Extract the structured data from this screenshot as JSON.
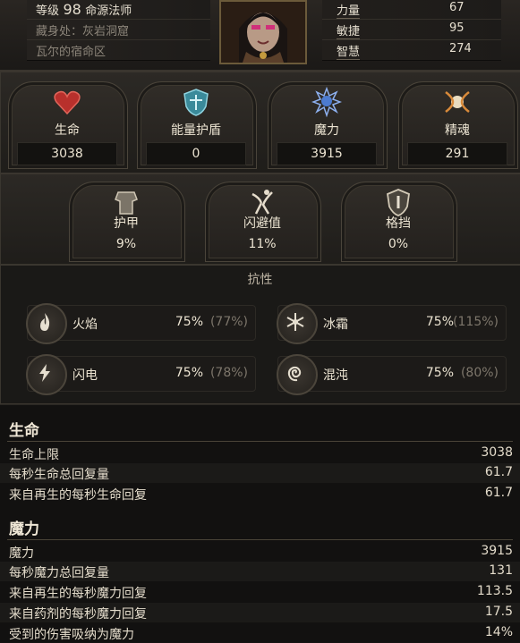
{
  "character": {
    "level_label": "等级",
    "level": "98",
    "class": "命源法师",
    "hideout_label": "藏身处：灰岩洞窟",
    "location": "瓦尔的宿命区"
  },
  "attributes": [
    {
      "name": "力量",
      "value": "67"
    },
    {
      "name": "敏捷",
      "value": "95"
    },
    {
      "name": "智慧",
      "value": "274"
    }
  ],
  "primary_stats": [
    {
      "name": "生命",
      "value": "3038",
      "icon": "heart-icon"
    },
    {
      "name": "能量护盾",
      "value": "0",
      "icon": "shield-crest-icon"
    },
    {
      "name": "魔力",
      "value": "3915",
      "icon": "mana-flower-icon"
    },
    {
      "name": "精魂",
      "value": "291",
      "icon": "spirit-orb-icon"
    }
  ],
  "defences": [
    {
      "name": "护甲",
      "value": "9%",
      "icon": "armour-icon"
    },
    {
      "name": "闪避值",
      "value": "11%",
      "icon": "evasion-icon"
    },
    {
      "name": "格挡",
      "value": "0%",
      "icon": "block-shield-icon"
    }
  ],
  "resistances": {
    "title": "抗性",
    "items": [
      {
        "name": "火焰",
        "value": "75%",
        "cap": "(77%)",
        "icon": "fire-icon"
      },
      {
        "name": "冰霜",
        "value": "75%",
        "cap": "(115%)",
        "icon": "snowflake-icon"
      },
      {
        "name": "闪电",
        "value": "75%",
        "cap": "(78%)",
        "icon": "lightning-icon"
      },
      {
        "name": "混沌",
        "value": "75%",
        "cap": "(80%)",
        "icon": "chaos-spiral-icon"
      }
    ]
  },
  "life_section": {
    "title": "生命",
    "rows": [
      {
        "label": "生命上限",
        "value": "3038"
      },
      {
        "label": "每秒生命总回复量",
        "value": "61.7"
      },
      {
        "label": "来自再生的每秒生命回复",
        "value": "61.7"
      }
    ]
  },
  "mana_section": {
    "title": "魔力",
    "rows": [
      {
        "label": "魔力",
        "value": "3915"
      },
      {
        "label": "每秒魔力总回复量",
        "value": "131"
      },
      {
        "label": "来自再生的每秒魔力回复",
        "value": "113.5"
      },
      {
        "label": "来自药剂的每秒魔力回复",
        "value": "17.5"
      },
      {
        "label": "受到的伤害吸纳为魔力",
        "value": "14%"
      }
    ]
  },
  "colors": {
    "accent_gold": "#6b5a3a",
    "text": "#ece4d2",
    "muted": "#7d766b"
  }
}
